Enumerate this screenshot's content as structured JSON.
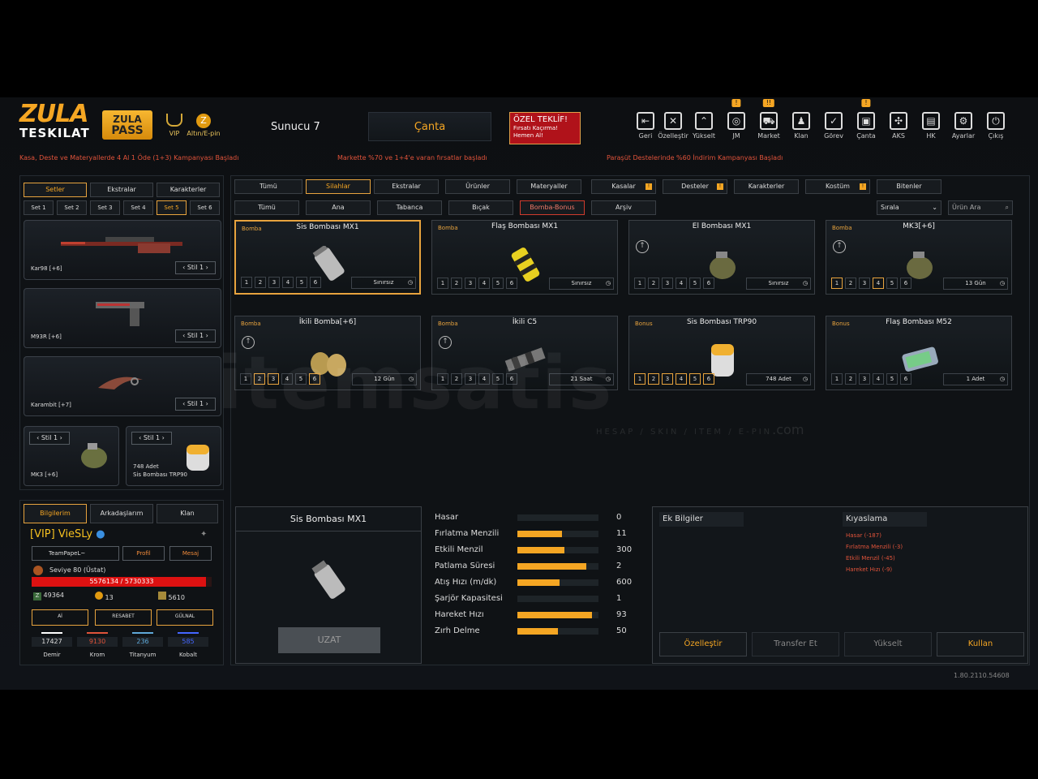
{
  "header": {
    "logo_line1": "ZULA",
    "logo_line2": "TESKILAT",
    "pass_line1": "ZULA",
    "pass_line2": "PASS",
    "vip_label": "VIP",
    "altin_label": "Altın/E-pin",
    "server": "Sunucu 7",
    "center_tab": "Çanta",
    "offer": {
      "title": "ÖZEL TEKLİF!",
      "line1": "Fırsatı Kaçırma!",
      "line2": "Hemen Al!"
    },
    "nav": [
      {
        "label": "Geri",
        "icon": "back-icon",
        "g": "⇤"
      },
      {
        "label": "Özelleştir",
        "icon": "tools-icon",
        "g": "✕"
      },
      {
        "label": "Yükselt",
        "icon": "upgrade-icon",
        "g": "⌃"
      },
      {
        "label": "JM",
        "icon": "coins-icon",
        "g": "◎",
        "badge": "!"
      },
      {
        "label": "Market",
        "icon": "cart-icon",
        "g": "⛟",
        "badge": "!!"
      },
      {
        "label": "Klan",
        "icon": "clan-icon",
        "g": "♟"
      },
      {
        "label": "Görev",
        "icon": "mission-icon",
        "g": "✓"
      },
      {
        "label": "Çanta",
        "icon": "bag-icon",
        "g": "▣",
        "badge": "!"
      },
      {
        "label": "AKS",
        "icon": "aks-icon",
        "g": "✣"
      },
      {
        "label": "HK",
        "icon": "wallet-icon",
        "g": "▤"
      },
      {
        "label": "Ayarlar",
        "icon": "gear-icon",
        "g": "⚙"
      },
      {
        "label": "Çıkış",
        "icon": "power-icon",
        "g": "⏻"
      }
    ],
    "promos": [
      "Kasa, Deste ve Materyallerde 4 Al 1 Öde (1+3) Kampanyası Başladı",
      "Markette %70 ve 1+4'e varan fırsatlar başladı",
      "Paraşüt Destelerinde %60 İndirim Kampanyası Başladı"
    ]
  },
  "left": {
    "tabs": [
      "Setler",
      "Ekstralar",
      "Karakterler"
    ],
    "sets": [
      "Set 1",
      "Set 2",
      "Set 3",
      "Set 4",
      "Set 5",
      "Set 6"
    ],
    "weapons": [
      {
        "name": "Kar98 [+6]",
        "style": "Stil 1"
      },
      {
        "name": "M93R [+6]",
        "style": "Stil 1"
      },
      {
        "name": "Karambit [+7]",
        "style": "Stil 1"
      }
    ],
    "small": [
      {
        "name": "MK3 [+6]",
        "style": "Stil 1"
      },
      {
        "name_top": "748 Adet",
        "name": "Sis Bombası TRP90",
        "style": "Stil 1"
      }
    ]
  },
  "profile": {
    "tabs": [
      "Bilgilerim",
      "Arkadaşlarım",
      "Klan"
    ],
    "player": "[VIP] VieSLy",
    "clan": "TeamPapeL~",
    "profile_btn": "Profil",
    "message_btn": "Mesaj",
    "level": "Seviye 80 (Üstat)",
    "xp": "5576134 / 5730333",
    "xp_ratio": 0.97,
    "stats": [
      "49364",
      "13",
      "5610"
    ],
    "badges": [
      "Aİ",
      "RESABET",
      "GÜLNAL"
    ],
    "resources": [
      {
        "value": "17427",
        "label": "Demir",
        "color": "#ffffff"
      },
      {
        "value": "9130",
        "label": "Krom",
        "color": "#e0533a"
      },
      {
        "value": "236",
        "label": "Titanyum",
        "color": "#5fa8d8"
      },
      {
        "value": "585",
        "label": "Kobalt",
        "color": "#4466ff"
      }
    ]
  },
  "filters": {
    "row1": [
      "Tümü",
      "Silahlar",
      "Ekstralar",
      "Ürünler",
      "Materyaller",
      "Kasalar",
      "Desteler",
      "Karakterler",
      "Kostüm",
      "Bitenler"
    ],
    "row2": [
      "Tümü",
      "Ana",
      "Tabanca",
      "Bıçak",
      "Bomba-Bonus",
      "Arşiv"
    ],
    "sort": "Sırala",
    "search_placeholder": "Ürün Ara"
  },
  "items": [
    {
      "cat": "Bomba",
      "title": "Sis Bombası MX1",
      "dur": "Sınırsız",
      "active": [],
      "up": false,
      "kind": "smoke"
    },
    {
      "cat": "Bomba",
      "title": "Flaş Bombası MX1",
      "dur": "Sınırsız",
      "active": [],
      "up": false,
      "kind": "flash"
    },
    {
      "cat": "",
      "title": "El Bombası MX1",
      "dur": "Sınırsız",
      "active": [],
      "up": true,
      "kind": "frag"
    },
    {
      "cat": "Bomba",
      "title": "MK3[+6]",
      "dur": "13 Gün",
      "active": [
        1,
        4
      ],
      "up": true,
      "kind": "frag"
    },
    {
      "cat": "Bomba",
      "title": "İkili Bomba[+6]",
      "dur": "12 Gün",
      "active": [
        2,
        3,
        6
      ],
      "up": true,
      "kind": "double"
    },
    {
      "cat": "Bomba",
      "title": "İkili C5",
      "dur": "21 Saat",
      "active": [],
      "up": true,
      "kind": "c5"
    },
    {
      "cat": "Bonus",
      "title": "Sis Bombası TRP90",
      "dur": "748 Adet",
      "active": [
        1,
        2,
        3,
        4,
        5,
        6
      ],
      "up": false,
      "kind": "smoke2"
    },
    {
      "cat": "Bonus",
      "title": "Flaş Bombası M52",
      "dur": "1 Adet",
      "active": [],
      "up": false,
      "kind": "flash2"
    }
  ],
  "detail": {
    "title": "Sis Bombası MX1",
    "button": "UZAT"
  },
  "stats": [
    {
      "label": "Hasar",
      "value": "0",
      "ratio": 0
    },
    {
      "label": "Fırlatma Menzili",
      "value": "11",
      "ratio": 0.55
    },
    {
      "label": "Etkili Menzil",
      "value": "300",
      "ratio": 0.58
    },
    {
      "label": "Patlama Süresi",
      "value": "2",
      "ratio": 0.85
    },
    {
      "label": "Atış Hızı (m/dk)",
      "value": "600",
      "ratio": 0.52
    },
    {
      "label": "Şarjör Kapasitesi",
      "value": "1",
      "ratio": 0
    },
    {
      "label": "Hareket Hızı",
      "value": "93",
      "ratio": 0.92
    },
    {
      "label": "Zırh Delme",
      "value": "50",
      "ratio": 0.5
    }
  ],
  "extra": {
    "title": "Ek Bilgiler",
    "compare_title": "Kıyaslama",
    "compare": [
      "Hasar (-187)",
      "Fırlatma Menzili (-3)",
      "Etkili Menzil (-45)",
      "Hareket Hızı (-9)"
    ],
    "buttons": [
      "Özelleştir",
      "Transfer Et",
      "Yükselt",
      "Kullan"
    ]
  },
  "version": "1.80.2110.54608",
  "watermark": {
    "main": "itemsatis",
    "sub": "HESAP / SKIN / ITEM / E-PIN",
    "com": ".com"
  }
}
